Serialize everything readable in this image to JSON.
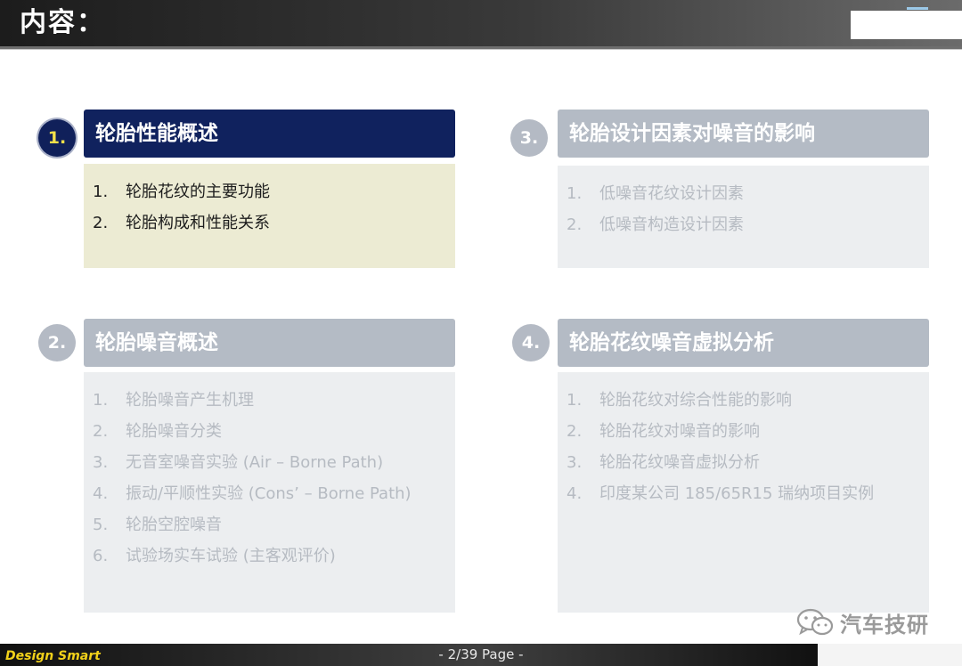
{
  "header": {
    "title": "内容："
  },
  "sections": [
    {
      "number": "1.",
      "title": "轮胎性能概述",
      "items": [
        {
          "n": "1.",
          "t": "轮胎花纹的主要功能"
        },
        {
          "n": "2.",
          "t": "轮胎构成和性能关系"
        }
      ]
    },
    {
      "number": "2.",
      "title": "轮胎噪音概述",
      "items": [
        {
          "n": "1.",
          "t": "轮胎噪音产生机理"
        },
        {
          "n": "2.",
          "t": "轮胎噪音分类"
        },
        {
          "n": "3.",
          "t": "无音室噪音实验 (Air – Borne Path)"
        },
        {
          "n": "4.",
          "t": "振动/平顺性实验 (Cons’   – Borne Path)"
        },
        {
          "n": "5.",
          "t": "轮胎空腔噪音"
        },
        {
          "n": "6.",
          "t": "试验场实车试验 (主客观评价)"
        }
      ]
    },
    {
      "number": "3.",
      "title": "轮胎设计因素对噪音的影响",
      "items": [
        {
          "n": "1.",
          "t": "低噪音花纹设计因素"
        },
        {
          "n": "2.",
          "t": "低噪音构造设计因素"
        }
      ]
    },
    {
      "number": "4.",
      "title": "轮胎花纹噪音虚拟分析",
      "items": [
        {
          "n": "1.",
          "t": "轮胎花纹对综合性能的影响"
        },
        {
          "n": "2.",
          "t": "轮胎花纹对噪音的影响"
        },
        {
          "n": "3.",
          "t": "轮胎花纹噪音虚拟分析"
        },
        {
          "n": "4.",
          "t": "印度某公司 185/65R15 瑞纳项目实例"
        }
      ]
    }
  ],
  "footer": {
    "brand": "Design Smart",
    "page": "- 2/39 Page -"
  },
  "watermark": {
    "text": "汽车技研",
    "icon": "wechat-icon"
  },
  "colors": {
    "active_header": "#10225e",
    "active_body": "#ecebd3",
    "dim_header": "#b4bbc5",
    "dim_body": "#eceef0",
    "badge_active_text": "#f3e04a"
  }
}
